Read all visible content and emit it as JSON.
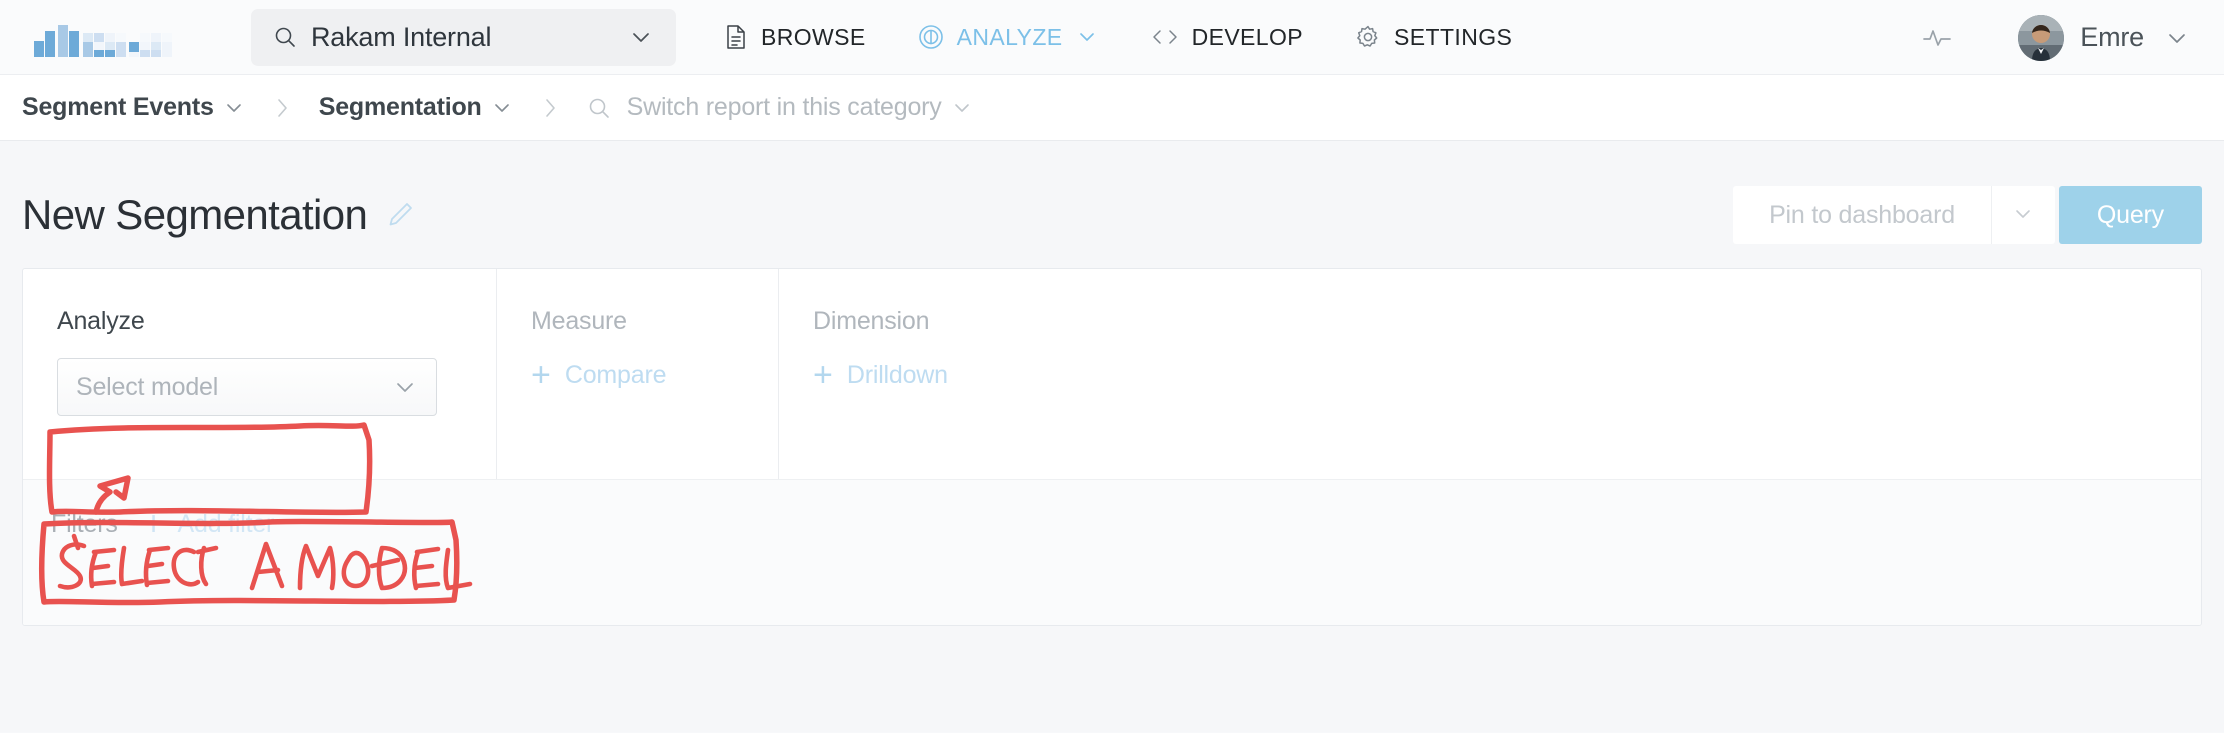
{
  "topnav": {
    "logo_name": "rakam-logo",
    "workspace": {
      "search_icon": "search-icon",
      "value": "Rakam Internal",
      "caret_icon": "chevron-down-icon"
    },
    "items": [
      {
        "label": "BROWSE",
        "icon": "document-icon",
        "active": false,
        "has_caret": false
      },
      {
        "label": "ANALYZE",
        "icon": "compass-icon",
        "active": true,
        "has_caret": true
      },
      {
        "label": "DEVELOP",
        "icon": "code-icon",
        "active": false,
        "has_caret": false
      },
      {
        "label": "SETTINGS",
        "icon": "gear-icon",
        "active": false,
        "has_caret": false
      }
    ],
    "pulse_icon": "activity-pulse-icon",
    "user": {
      "name": "Emre",
      "avatar_name": "user-avatar",
      "caret_icon": "chevron-down-icon"
    }
  },
  "breadcrumb": {
    "items": [
      {
        "label": "Segment Events",
        "has_caret": true,
        "is_search": false
      },
      {
        "label": "Segmentation",
        "has_caret": true,
        "is_search": false
      }
    ],
    "search": {
      "label": "Switch report in this category",
      "icon": "search-icon",
      "caret_icon": "chevron-down-icon"
    },
    "separator_icon": "chevron-right-icon"
  },
  "page": {
    "title": "New Segmentation",
    "edit_icon": "pencil-edit-icon",
    "pin_label": "Pin to dashboard",
    "pin_caret_icon": "chevron-down-icon",
    "query_label": "Query"
  },
  "query_card": {
    "analyze": {
      "label": "Analyze",
      "select_placeholder": "Select model",
      "caret_icon": "chevron-down-icon"
    },
    "measure": {
      "label": "Measure",
      "add_label": "Compare",
      "plus": "+"
    },
    "dimension": {
      "label": "Dimension",
      "add_label": "Drilldown",
      "plus": "+"
    },
    "filters": {
      "label": "Filters",
      "add_label": "Add filter",
      "plus": "+"
    }
  },
  "annotation": {
    "text": "SELECT A MODEL",
    "color": "#e8524f"
  },
  "colors": {
    "accent": "#9ed2ea",
    "nav_active": "#7cc0e8",
    "annotation": "#e8524f",
    "page_bg": "#f6f7f9"
  }
}
